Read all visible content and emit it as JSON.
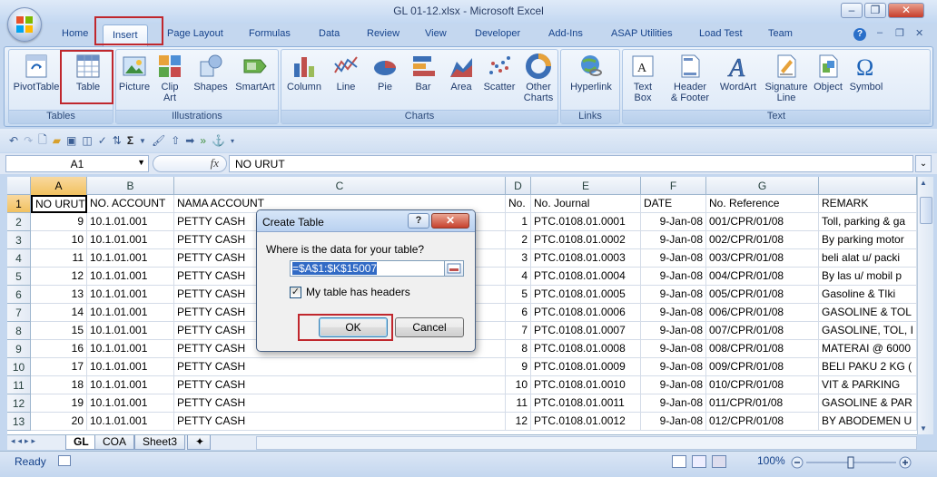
{
  "window": {
    "title": "GL 01-12.xlsx - Microsoft Excel",
    "minimize": "–",
    "restore": "❐",
    "close": "✕"
  },
  "ribbon_tabs": [
    "Home",
    "Insert",
    "Page Layout",
    "Formulas",
    "Data",
    "Review",
    "View",
    "Developer",
    "Add-Ins",
    "ASAP Utilities",
    "Load Test",
    "Team"
  ],
  "active_tab": "Insert",
  "groups": {
    "tables": {
      "label": "Tables",
      "pivot": "PivotTable",
      "table": "Table"
    },
    "illustrations": {
      "label": "Illustrations",
      "picture": "Picture",
      "clipart_1": "Clip",
      "clipart_2": "Art",
      "shapes": "Shapes",
      "smartart": "SmartArt"
    },
    "charts": {
      "label": "Charts",
      "column": "Column",
      "line": "Line",
      "pie": "Pie",
      "bar": "Bar",
      "area": "Area",
      "scatter": "Scatter",
      "other_1": "Other",
      "other_2": "Charts"
    },
    "links": {
      "label": "Links",
      "hyperlink": "Hyperlink"
    },
    "text": {
      "label": "Text",
      "textbox_1": "Text",
      "textbox_2": "Box",
      "header_1": "Header",
      "header_2": "& Footer",
      "wordart": "WordArt",
      "signature_1": "Signature",
      "signature_2": "Line",
      "object": "Object",
      "symbol": "Symbol"
    }
  },
  "formula_bar": {
    "name_box": "A1",
    "fx": "fx",
    "value": "NO URUT"
  },
  "columns": [
    "A",
    "B",
    "C",
    "D",
    "E",
    "F",
    "G",
    ""
  ],
  "rows": [
    [
      "1",
      "NO URUT",
      "NO. ACCOUNT",
      "NAMA ACCOUNT",
      "No.",
      "No. Journal",
      "DATE",
      "No. Reference",
      "REMARK"
    ],
    [
      "2",
      "9",
      "10.1.01.001",
      "PETTY CASH",
      "1",
      "PTC.0108.01.0001",
      "9-Jan-08",
      "001/CPR/01/08",
      "Toll, parking & ga"
    ],
    [
      "3",
      "10",
      "10.1.01.001",
      "PETTY CASH",
      "2",
      "PTC.0108.01.0002",
      "9-Jan-08",
      "002/CPR/01/08",
      "By parking motor"
    ],
    [
      "4",
      "11",
      "10.1.01.001",
      "PETTY CASH",
      "3",
      "PTC.0108.01.0003",
      "9-Jan-08",
      "003/CPR/01/08",
      "beli alat u/ packi"
    ],
    [
      "5",
      "12",
      "10.1.01.001",
      "PETTY CASH",
      "4",
      "PTC.0108.01.0004",
      "9-Jan-08",
      "004/CPR/01/08",
      "By las u/ mobil p"
    ],
    [
      "6",
      "13",
      "10.1.01.001",
      "PETTY CASH",
      "5",
      "PTC.0108.01.0005",
      "9-Jan-08",
      "005/CPR/01/08",
      "Gasoline & TIki"
    ],
    [
      "7",
      "14",
      "10.1.01.001",
      "PETTY CASH",
      "6",
      "PTC.0108.01.0006",
      "9-Jan-08",
      "006/CPR/01/08",
      "GASOLINE & TOL"
    ],
    [
      "8",
      "15",
      "10.1.01.001",
      "PETTY CASH",
      "7",
      "PTC.0108.01.0007",
      "9-Jan-08",
      "007/CPR/01/08",
      "GASOLINE, TOL, I"
    ],
    [
      "9",
      "16",
      "10.1.01.001",
      "PETTY CASH",
      "8",
      "PTC.0108.01.0008",
      "9-Jan-08",
      "008/CPR/01/08",
      "MATERAI @ 6000"
    ],
    [
      "10",
      "17",
      "10.1.01.001",
      "PETTY CASH",
      "9",
      "PTC.0108.01.0009",
      "9-Jan-08",
      "009/CPR/01/08",
      "BELI PAKU 2 KG ("
    ],
    [
      "11",
      "18",
      "10.1.01.001",
      "PETTY CASH",
      "10",
      "PTC.0108.01.0010",
      "9-Jan-08",
      "010/CPR/01/08",
      "VIT & PARKING"
    ],
    [
      "12",
      "19",
      "10.1.01.001",
      "PETTY CASH",
      "11",
      "PTC.0108.01.0011",
      "9-Jan-08",
      "011/CPR/01/08",
      "GASOLINE & PAR"
    ],
    [
      "13",
      "20",
      "10.1.01.001",
      "PETTY CASH",
      "12",
      "PTC.0108.01.0012",
      "9-Jan-08",
      "012/CPR/01/08",
      "BY ABODEMEN U"
    ]
  ],
  "sheets": [
    "GL",
    "COA",
    "Sheet3"
  ],
  "active_sheet": "GL",
  "status": {
    "ready": "Ready",
    "zoom": "100%"
  },
  "dialog": {
    "title": "Create Table",
    "help": "?",
    "close": "✕",
    "question": "Where is the data for your table?",
    "range": "=$A$1:$K$15007",
    "checkbox_label": "My table has headers",
    "ok": "OK",
    "cancel": "Cancel"
  }
}
